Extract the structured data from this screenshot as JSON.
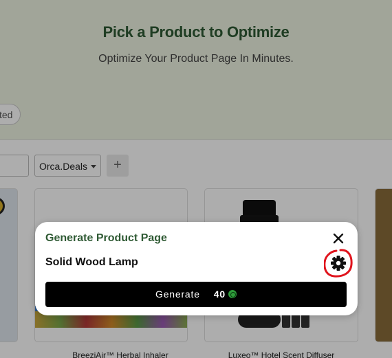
{
  "hero": {
    "title": "Pick a Product to Optimize",
    "subtitle": "Optimize Your Product Page In Minutes."
  },
  "filters": {
    "chip_label": "ted",
    "store_select_value": "Orca.Deals",
    "add_label": "+"
  },
  "products": [
    {
      "name": "BreeziAir™ Herbal Inhaler"
    },
    {
      "name": "Luxeo™ Hotel Scent Diffuser"
    }
  ],
  "modal": {
    "title": "Generate Product Page",
    "product_name": "Solid Wood Lamp",
    "generate_label": "Generate",
    "credits": "40",
    "close_icon": "close-icon",
    "settings_icon": "gear-icon",
    "annotation_color": "#e0141d"
  },
  "colors": {
    "brand_green": "#2f5a34",
    "hero_bg": "#eef3e2",
    "button_bg": "#000000"
  }
}
